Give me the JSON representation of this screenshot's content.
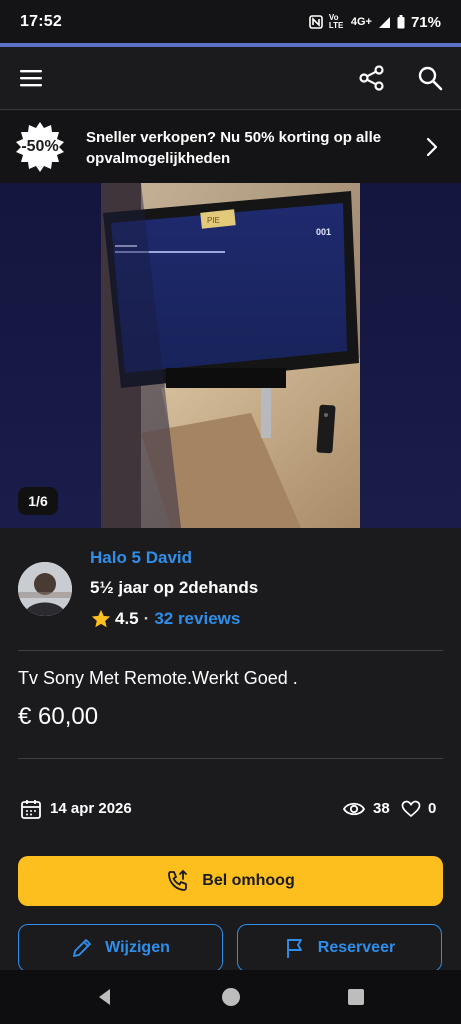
{
  "status_bar": {
    "time": "17:52",
    "network": "4G+",
    "volte": "Vo LTE",
    "battery": "71%"
  },
  "app_bar": {
    "menu_icon": "hamburger-icon",
    "share_icon": "share-icon",
    "search_icon": "search-icon"
  },
  "promo": {
    "badge": "-50%",
    "text": "Sneller verkopen? Nu 50% korting op alle opvalmogelijkheden"
  },
  "gallery": {
    "counter": "1/6",
    "tv_channel": "001",
    "tv_sticker": "PIE"
  },
  "seller": {
    "name": "Halo 5 David",
    "since": "5½ jaar op 2dehands",
    "rating": "4.5",
    "separator": "·",
    "reviews": "32 reviews"
  },
  "listing": {
    "title": "Tv Sony Met Remote.Werkt Goed .",
    "price": "€ 60,00"
  },
  "meta": {
    "date": "14 apr 2026",
    "views": "38",
    "likes": "0"
  },
  "actions": {
    "bump": "Bel omhoog",
    "edit": "Wijzigen",
    "reserve": "Reserveer"
  },
  "colors": {
    "accent_blue": "#2f8eea",
    "bump_yellow": "#fdbf1e",
    "background": "#1b1b1d"
  }
}
